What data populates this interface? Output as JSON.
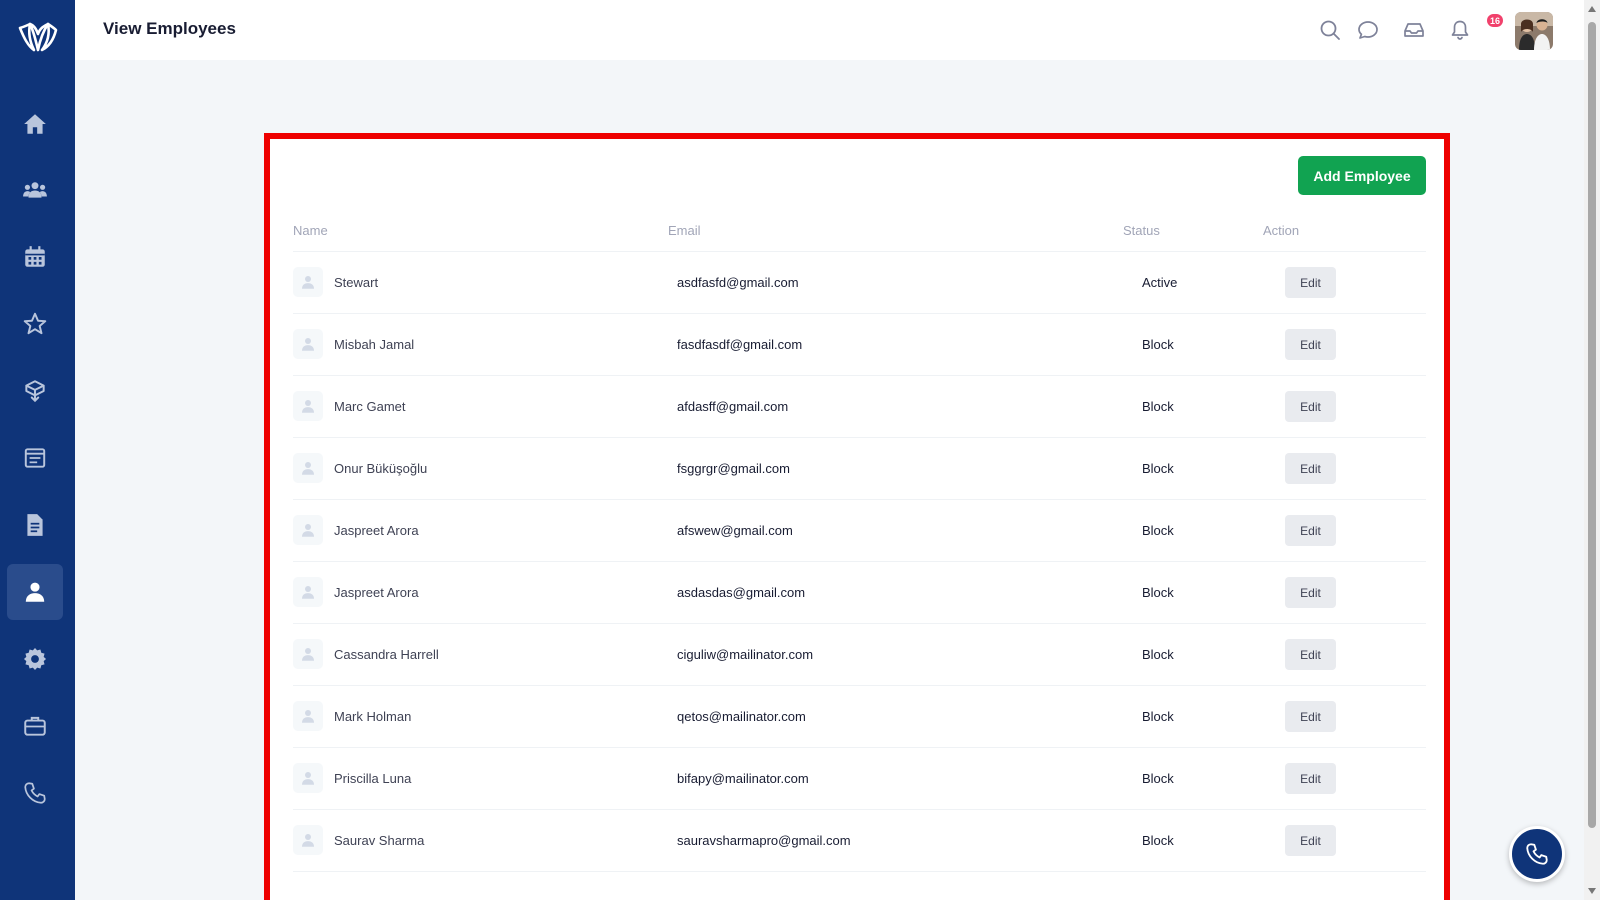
{
  "header": {
    "title": "View Employees",
    "notification_count": "16"
  },
  "sidebar": {
    "items": [
      {
        "icon": "home-icon"
      },
      {
        "icon": "users-icon"
      },
      {
        "icon": "calendar-icon"
      },
      {
        "icon": "star-icon"
      },
      {
        "icon": "box-icon"
      },
      {
        "icon": "board-icon"
      },
      {
        "icon": "document-icon"
      },
      {
        "icon": "user-icon",
        "active": true
      },
      {
        "icon": "gear-icon"
      },
      {
        "icon": "briefcase-icon"
      },
      {
        "icon": "phone-icon"
      }
    ]
  },
  "employees": {
    "add_button_label": "Add Employee",
    "columns": [
      "Name",
      "Email",
      "Status",
      "Action"
    ],
    "rows": [
      {
        "name": "Stewart",
        "email": "asdfasfd@gmail.com",
        "status": "Active",
        "action": "Edit"
      },
      {
        "name": "Misbah Jamal",
        "email": "fasdfasdf@gmail.com",
        "status": "Block",
        "action": "Edit"
      },
      {
        "name": "Marc Gamet",
        "email": "afdasff@gmail.com",
        "status": "Block",
        "action": "Edit"
      },
      {
        "name": "Onur Büküşoğlu",
        "email": "fsggrgr@gmail.com",
        "status": "Block",
        "action": "Edit"
      },
      {
        "name": "Jaspreet Arora",
        "email": "afswew@gmail.com",
        "status": "Block",
        "action": "Edit"
      },
      {
        "name": "Jaspreet Arora",
        "email": "asdasdas@gmail.com",
        "status": "Block",
        "action": "Edit"
      },
      {
        "name": "Cassandra Harrell",
        "email": "ciguliw@mailinator.com",
        "status": "Block",
        "action": "Edit"
      },
      {
        "name": "Mark Holman",
        "email": "qetos@mailinator.com",
        "status": "Block",
        "action": "Edit"
      },
      {
        "name": "Priscilla Luna",
        "email": "bifapy@mailinator.com",
        "status": "Block",
        "action": "Edit"
      },
      {
        "name": "Saurav Sharma",
        "email": "sauravsharmapro@gmail.com",
        "status": "Block",
        "action": "Edit"
      }
    ]
  },
  "colors": {
    "sidebar": "#0f3479",
    "primary_button": "#11a351",
    "highlight_border": "#ee0000",
    "badge": "#f1416c"
  }
}
